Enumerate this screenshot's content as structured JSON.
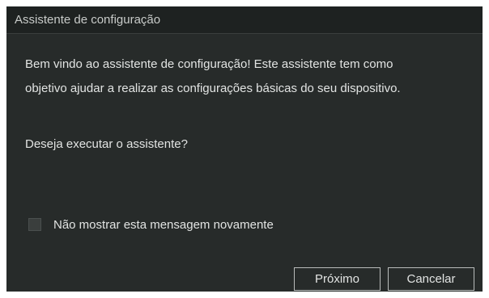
{
  "dialog": {
    "title": "Assistente de configuração",
    "message_line1": "Bem vindo ao assistente de configuração! Este assistente tem como",
    "message_line2": "objetivo ajudar a realizar as configurações básicas do seu dispositivo.",
    "question": "Deseja executar o assistente?",
    "checkbox": {
      "label": "Não mostrar esta mensagem novamente",
      "checked": false
    },
    "buttons": {
      "next_label": "Próximo",
      "cancel_label": "Cancelar"
    }
  },
  "colors": {
    "dialog_background": "#272b2a",
    "titlebar_background": "#1e2221",
    "text": "#e2e4e3",
    "button_border": "#b9bcbb"
  }
}
